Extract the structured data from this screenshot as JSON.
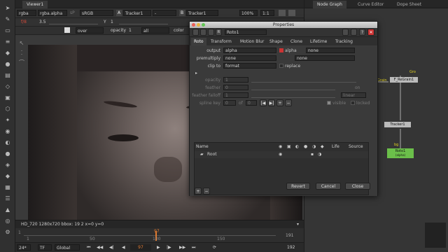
{
  "viewer": {
    "tab": "Viewer1",
    "ctl1": {
      "channels": "rgba",
      "layer": "rgba.alpha",
      "colorspace_prefix": "sP",
      "colorspace": "sRGB",
      "a_input": "Tracker1",
      "a_letter": "A",
      "dash": "-",
      "b_letter": "B",
      "b_input": "Tracker1",
      "zoom": "100%",
      "ratio": "1:1"
    },
    "ctl2": {
      "fstop": "f/8",
      "gain": "3.5",
      "y_label": "Y",
      "y_value": "1"
    },
    "ctl3": {
      "mode": "over",
      "opacity_label": "opacity",
      "opacity_value": "1",
      "channels": "all",
      "color_label": "color"
    },
    "status": "HD_720 1280x720  bbox: 19 2  x=0 y=0",
    "timeline": {
      "start_label": "1",
      "ticks": [
        "1",
        "50",
        "100",
        "150",
        "191"
      ],
      "marker": "97",
      "end": "191"
    },
    "playback": {
      "fps": "24*",
      "tf": "TF",
      "scope": "Global",
      "frame": "97",
      "end_frame": "192"
    }
  },
  "right_panel": {
    "tabs": [
      "Node Graph",
      "Curve Editor",
      "Dope Sheet"
    ],
    "nodes": {
      "regrain_tag": "Gro",
      "regrain": "F_ReGrain1",
      "grain_tag": "Grain",
      "tracker": "Tracker1",
      "bg_tag": "bg",
      "roto": "Roto1",
      "roto_sub": "(alpha)"
    }
  },
  "dialog": {
    "title": "Properties",
    "node_name": "Roto1",
    "tabs": [
      "Roto",
      "Transform",
      "Motion Blur",
      "Shape",
      "Clone",
      "Lifetime",
      "Tracking"
    ],
    "output_label": "output",
    "output_value": "alpha",
    "alpha_label": "alpha",
    "none1": "none",
    "premult_label": "premultiply",
    "premult_value": "none",
    "none2": "none",
    "clipto_label": "clip to",
    "clipto_value": "format",
    "replace_label": "replace",
    "opacity_label": "opacity",
    "opacity_value": "1",
    "feather_label": "feather",
    "feather_value": "0",
    "on_label": "on",
    "falloff_label": "feather falloff",
    "falloff_value": "1",
    "falloff_type": "linear",
    "splinekey_label": "spline key",
    "splinekey_value": "0",
    "of_label": "of",
    "of_value": "0",
    "visible_label": "visible",
    "locked_label": "locked",
    "table_name_col": "Name",
    "table_life_col": "Life",
    "table_source_col": "Source",
    "root_label": "Root",
    "revert_btn": "Revert",
    "cancel_btn": "Cancel",
    "close_btn": "Close"
  },
  "colors": {
    "accent_red": "#d44a3a",
    "node_green": "#6bbf4a",
    "node_grey": "#bbbbbb",
    "playhead": "#e07a30"
  }
}
